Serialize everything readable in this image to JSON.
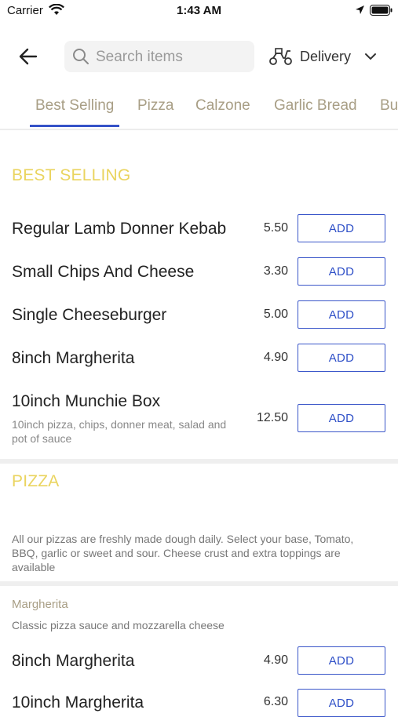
{
  "status_bar": {
    "carrier": "Carrier",
    "time": "1:43 AM"
  },
  "header": {
    "search_placeholder": "Search items",
    "delivery_label": "Delivery"
  },
  "tabs": [
    {
      "label": "Best Selling"
    },
    {
      "label": "Pizza"
    },
    {
      "label": "Calzone"
    },
    {
      "label": "Garlic Bread"
    },
    {
      "label": "Bu"
    }
  ],
  "colors": {
    "accent": "#3a56c9",
    "section_title": "#ead45f",
    "tab_text": "#a89e85"
  },
  "best_selling": {
    "title": "BEST SELLING",
    "items": [
      {
        "name": "Regular Lamb Donner Kebab",
        "price": "5.50",
        "button": "ADD"
      },
      {
        "name": "Small Chips And Cheese",
        "price": "3.30",
        "button": "ADD"
      },
      {
        "name": "Single Cheeseburger",
        "price": "5.00",
        "button": "ADD"
      },
      {
        "name": "8inch Margherita",
        "price": "4.90",
        "button": "ADD"
      },
      {
        "name": "10inch Munchie Box",
        "description": "10inch pizza, chips, donner meat, salad and pot of sauce",
        "price": "12.50",
        "button": "ADD"
      }
    ]
  },
  "pizza": {
    "title": "PIZZA",
    "info": "All our pizzas are freshly made dough daily. Select your base, Tomato, BBQ, garlic or sweet and sour. Cheese crust and extra toppings are available",
    "subcategory": {
      "name": "Margherita",
      "description": "Classic pizza sauce and mozzarella cheese"
    },
    "items": [
      {
        "name": "8inch Margherita",
        "price": "4.90",
        "button": "ADD"
      },
      {
        "name": "10inch Margherita",
        "price": "6.30",
        "button": "ADD"
      }
    ]
  }
}
